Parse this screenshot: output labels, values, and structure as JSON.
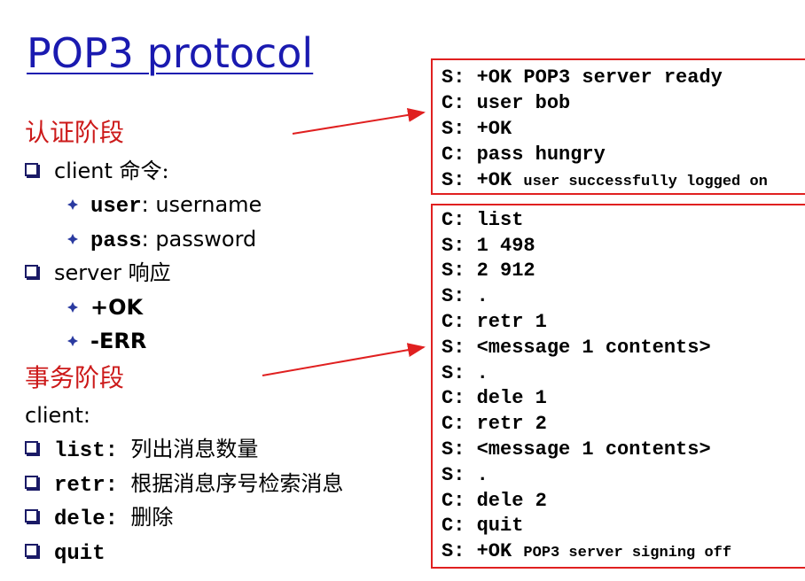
{
  "title": "POP3 protocol",
  "auth": {
    "heading": "认证阶段",
    "client_word": "client",
    "client_rest": " 命令:",
    "user_cmd": "user",
    "user_desc": ": username",
    "pass_cmd": "pass",
    "pass_desc": ": password",
    "server_word": "server",
    "server_rest": " 响应",
    "ok": "+OK",
    "err": "-ERR"
  },
  "transaction": {
    "heading": "事务阶段",
    "client_label": "client:",
    "commands": [
      {
        "cmd": "list",
        "desc": "列出消息数量"
      },
      {
        "cmd": "retr",
        "desc": "根据消息序号检索消息"
      },
      {
        "cmd": "dele",
        "desc": "删除"
      },
      {
        "cmd": "quit",
        "desc": ""
      }
    ]
  },
  "auth_session": {
    "lines": [
      {
        "who": "S:",
        "text": "+OK POP3 server ready",
        "small": ""
      },
      {
        "who": "C:",
        "text": "user bob",
        "small": ""
      },
      {
        "who": "S:",
        "text": "+OK",
        "small": ""
      },
      {
        "who": "C:",
        "text": "pass hungry",
        "small": ""
      },
      {
        "who": "S:",
        "text": "+OK",
        "small": "user successfully logged on"
      }
    ]
  },
  "transaction_session": {
    "lines": [
      {
        "who": "C:",
        "text": "list",
        "small": ""
      },
      {
        "who": "S:",
        "text": "1 498",
        "small": ""
      },
      {
        "who": "S:",
        "text": "2 912",
        "small": ""
      },
      {
        "who": "S:",
        "text": ".",
        "small": ""
      },
      {
        "who": "C:",
        "text": "retr 1",
        "small": ""
      },
      {
        "who": "S:",
        "text": "<message 1 contents>",
        "small": ""
      },
      {
        "who": "S:",
        "text": ".",
        "small": ""
      },
      {
        "who": "C:",
        "text": "dele 1",
        "small": ""
      },
      {
        "who": "C:",
        "text": "retr 2",
        "small": ""
      },
      {
        "who": "S:",
        "text": "<message 1 contents>",
        "small": ""
      },
      {
        "who": "S:",
        "text": ".",
        "small": ""
      },
      {
        "who": "C:",
        "text": "dele 2",
        "small": ""
      },
      {
        "who": "C:",
        "text": "quit",
        "small": ""
      },
      {
        "who": "S:",
        "text": "+OK",
        "small": "POP3 server signing off"
      }
    ]
  },
  "colors": {
    "title": "#1a1ab0",
    "heading": "#cc1a1a",
    "box_border": "#e02020",
    "arrow": "#e02020",
    "bullet": "#1a1a66",
    "diamond": "#2a3aa0"
  }
}
